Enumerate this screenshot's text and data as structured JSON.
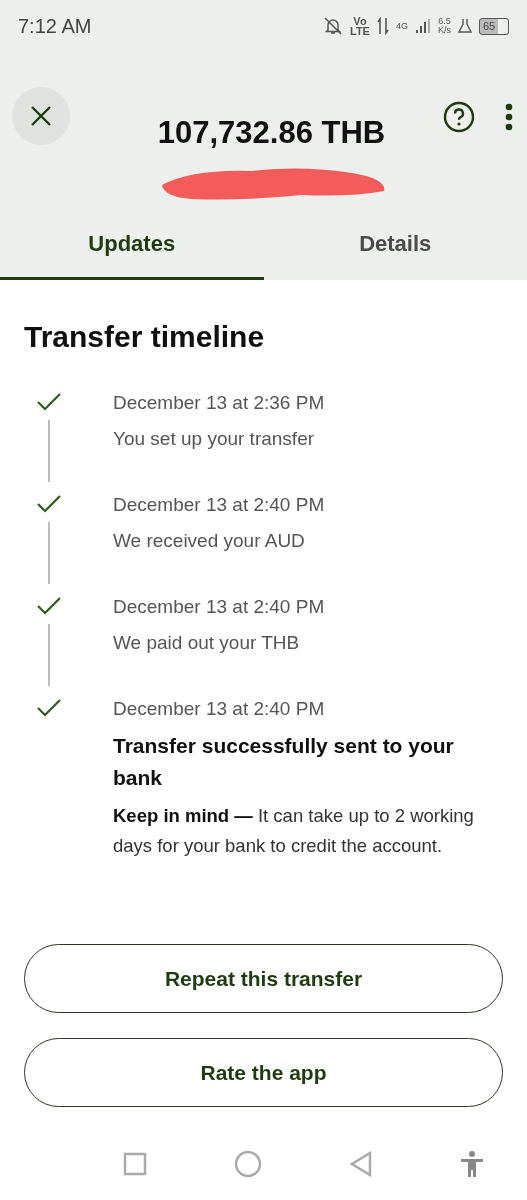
{
  "status_bar": {
    "time": "7:12 AM",
    "network": "Vo",
    "network_sub": "LTE",
    "signal_label": "4G",
    "speed": "6.5",
    "speed_unit": "K/s",
    "battery": "65"
  },
  "header": {
    "amount": "107,732.86 THB",
    "recipient_redacted": true
  },
  "tabs": [
    {
      "label": "Updates",
      "selected": true
    },
    {
      "label": "Details",
      "selected": false
    }
  ],
  "timeline": {
    "title": "Transfer timeline",
    "events": [
      {
        "kind": "step",
        "date": "December 13 at 2:36 PM",
        "text": "You set up your transfer",
        "done": true
      },
      {
        "kind": "step",
        "date": "December 13 at 2:40 PM",
        "text": "We received your AUD",
        "done": true
      },
      {
        "kind": "step",
        "date": "December 13 at 2:40 PM",
        "text": "We paid out your THB",
        "done": true
      },
      {
        "kind": "final",
        "date": "December 13 at 2:40 PM",
        "text": "Transfer successfully sent to your bank",
        "note": "**Keep in mind —** It can take up to 2 working days for your bank to credit the account.",
        "done": true
      }
    ]
  },
  "buttons": [
    "Repeat this transfer",
    "Rate the app"
  ]
}
